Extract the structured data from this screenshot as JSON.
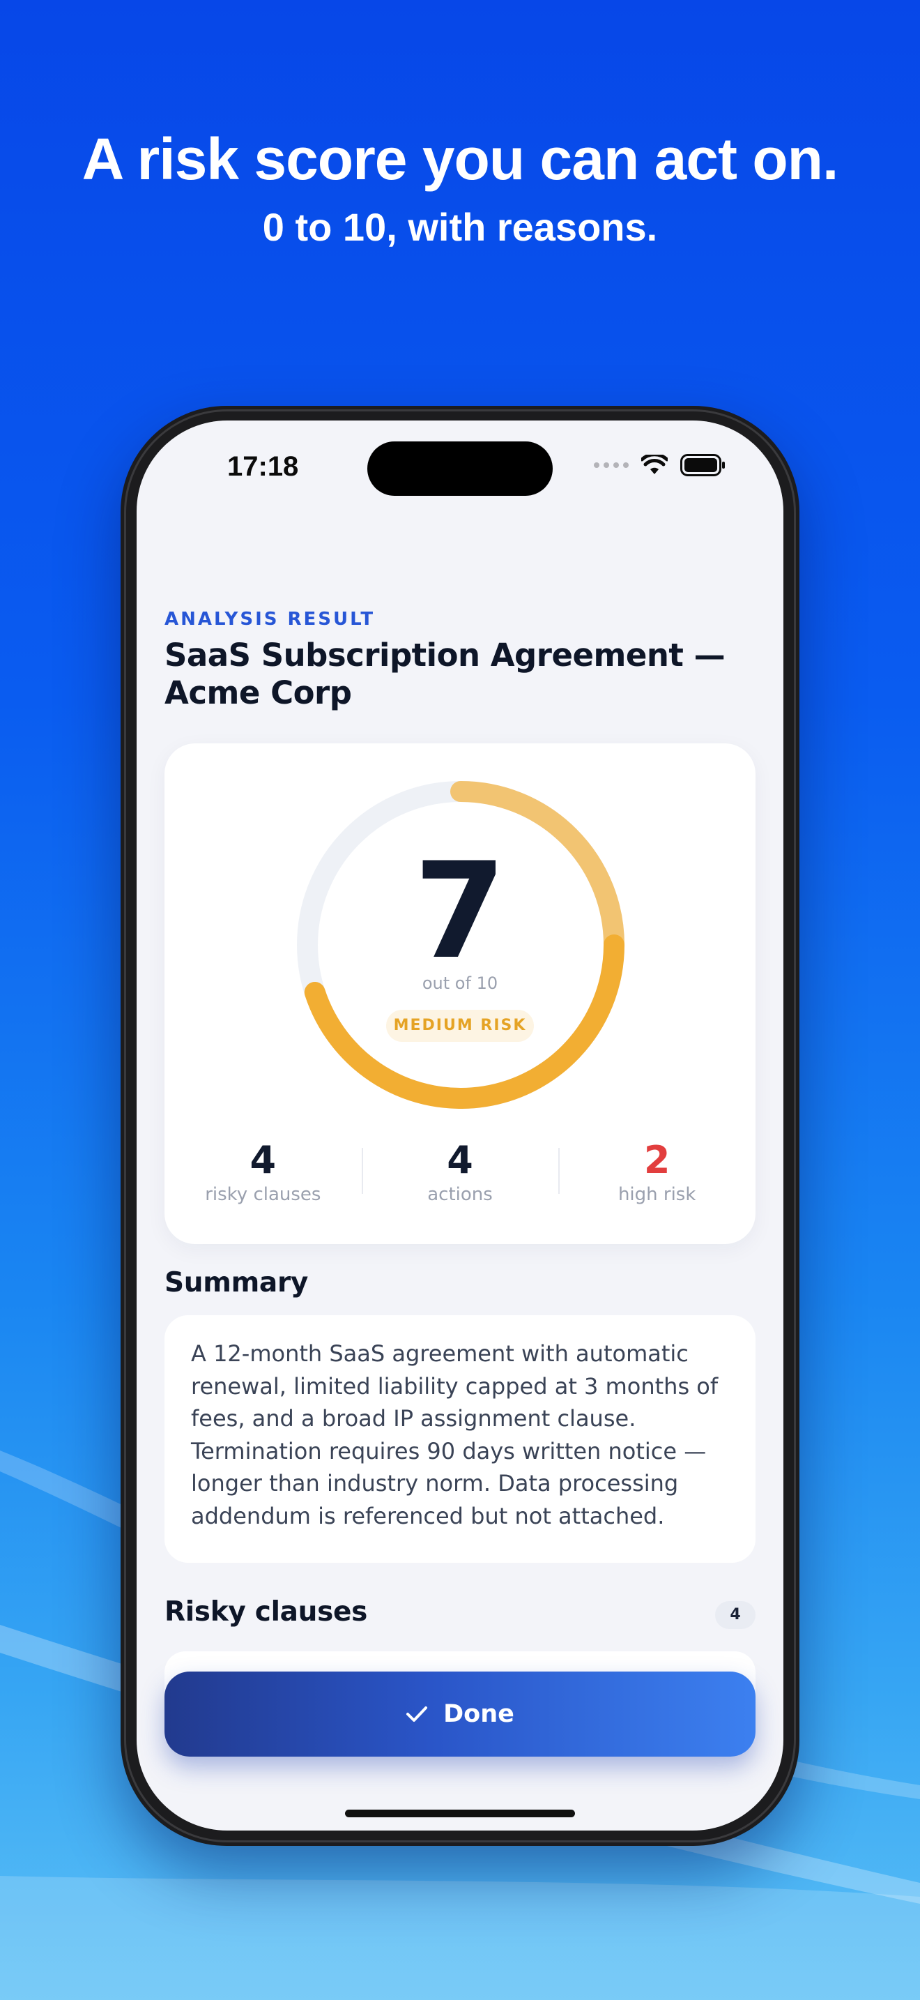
{
  "hero": {
    "title": "A risk score you can act on.",
    "subtitle": "0 to 10, with reasons."
  },
  "status_bar": {
    "time": "17:18",
    "icons": [
      "cellular-signal-icon",
      "wifi-icon",
      "battery-icon"
    ]
  },
  "header": {
    "eyebrow": "ANALYSIS RESULT",
    "title_line1": "SaaS Subscription Agreement —",
    "title_line2": "Acme Corp"
  },
  "score": {
    "value": "7",
    "out_of": "out of 10",
    "fraction": 0.7,
    "risk_label": "MEDIUM RISK"
  },
  "stats": [
    {
      "value": "4",
      "label": "risky clauses"
    },
    {
      "value": "4",
      "label": "actions"
    },
    {
      "value": "2",
      "label": "high risk"
    }
  ],
  "summary": {
    "heading": "Summary",
    "text": "A 12-month SaaS agreement with automatic renewal, limited liability capped at 3 months of fees, and a broad IP assignment clause. Termination requires 90 days written notice — longer than industry norm. Data processing addendum is referenced but not attached."
  },
  "risky_clauses": {
    "heading": "Risky clauses",
    "count": "4"
  },
  "actions": {
    "done_label": "Done"
  },
  "colors": {
    "accent": "#2756d6",
    "warning": "#f2ae33",
    "warning_light": "#f2c472",
    "danger": "#e23e3e",
    "ring_track": "#eef1f6"
  }
}
